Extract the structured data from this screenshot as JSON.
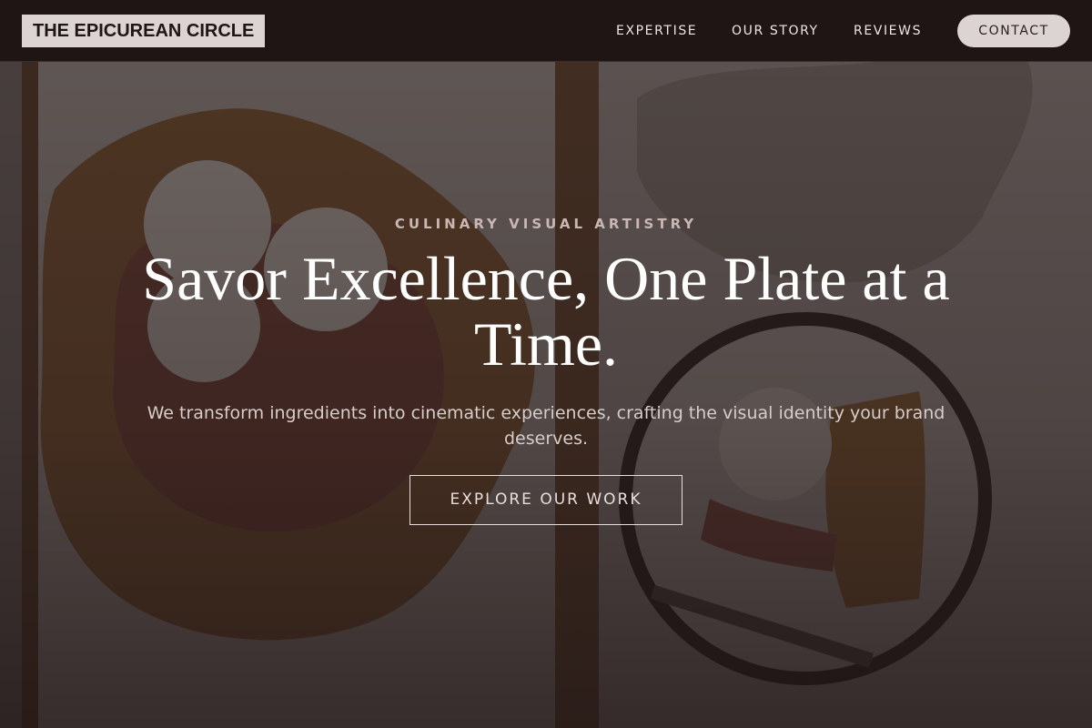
{
  "nav": {
    "logo": "THE EPICUREAN CIRCLE",
    "links": [
      {
        "label": "EXPERTISE"
      },
      {
        "label": "OUR STORY"
      },
      {
        "label": "REVIEWS"
      }
    ],
    "contact_label": "CONTACT"
  },
  "hero": {
    "eyebrow": "CULINARY VISUAL ARTISTRY",
    "headline": "Savor Excellence, One Plate at a Time.",
    "subtext": "We transform ingredients into cinematic experiences, crafting the visual identity your brand deserves.",
    "cta_label": "EXPLORE OUR WORK",
    "image": "galette-with-ice-cream-photo"
  },
  "colors": {
    "nav_background": "#1f1515",
    "pill_background": "#dcd4d2",
    "overlay": "#1e1414",
    "eyebrow_text": "#c8b7b3",
    "body_text": "#d6cdcb"
  }
}
